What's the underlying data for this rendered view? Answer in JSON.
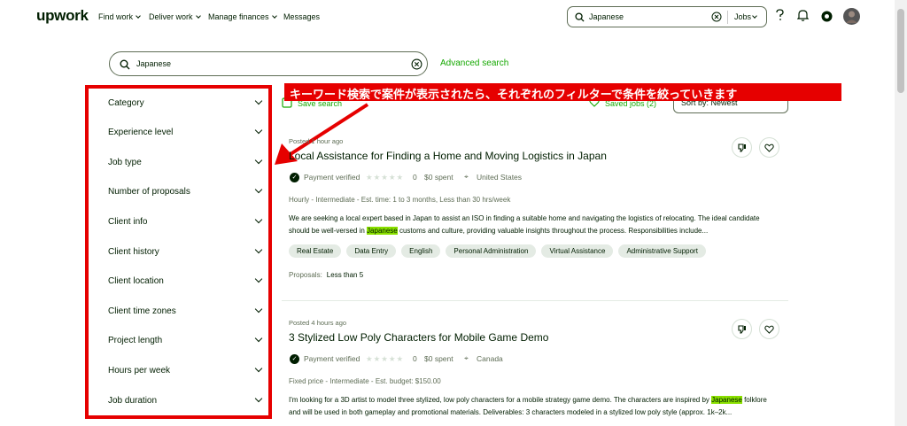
{
  "header": {
    "logo": "upwork",
    "nav": [
      {
        "label": "Find work",
        "dropdown": true
      },
      {
        "label": "Deliver work",
        "dropdown": true
      },
      {
        "label": "Manage finances",
        "dropdown": true
      },
      {
        "label": "Messages",
        "dropdown": false
      }
    ],
    "search_value": "Japanese",
    "search_scope": "Jobs"
  },
  "search": {
    "value": "Japanese",
    "advanced_label": "Advanced search"
  },
  "filters": [
    "Category",
    "Experience level",
    "Job type",
    "Number of proposals",
    "Client info",
    "Client history",
    "Client location",
    "Client time zones",
    "Project length",
    "Hours per week",
    "Job duration"
  ],
  "toolbar": {
    "save_search": "Save search",
    "saved_jobs": "Saved jobs (2)",
    "sort": "Sort by: Newest"
  },
  "annotation": {
    "text": "キーワード検索で案件が表示されたら、それぞれのフィルターで条件を絞っていきます"
  },
  "jobs": [
    {
      "posted": "Posted 1 hour ago",
      "title": "Local Assistance for Finding a Home and Moving Logistics in Japan",
      "payment": "Payment verified",
      "rating": "0",
      "spent": "$0 spent",
      "location": "United States",
      "info": "Hourly - Intermediate - Est. time: 1 to 3 months, Less than 30 hrs/week",
      "desc_a": "We are seeking a local expert based in Japan to assist an ISO in finding a suitable home and navigating the logistics of relocating. The ideal candidate should be well-versed in ",
      "desc_hl": "Japanese",
      "desc_b": " customs and culture, providing valuable insights throughout the process. Responsibilities include...",
      "tags": [
        "Real Estate",
        "Data Entry",
        "English",
        "Personal Administration",
        "Virtual Assistance",
        "Administrative Support"
      ],
      "proposals_label": "Proposals:",
      "proposals_value": "Less than 5"
    },
    {
      "posted": "Posted 4 hours ago",
      "title": "3 Stylized Low Poly Characters for Mobile Game Demo",
      "payment": "Payment verified",
      "rating": "0",
      "spent": "$0 spent",
      "location": "Canada",
      "info": "Fixed price - Intermediate - Est. budget: $150.00",
      "desc_a": "I'm looking for a 3D artist to model three stylized, low poly characters for a mobile strategy game demo. The characters are inspired by ",
      "desc_hl": "Japanese",
      "desc_b": " folklore and will be used in both gameplay and promotional materials. Deliverables: 3 characters modeled in a stylized low poly style (approx. 1k–2k..."
    }
  ],
  "colors": {
    "brand_green": "#14a800",
    "annotation_red": "#e60000",
    "highlight": "#8ae000"
  }
}
